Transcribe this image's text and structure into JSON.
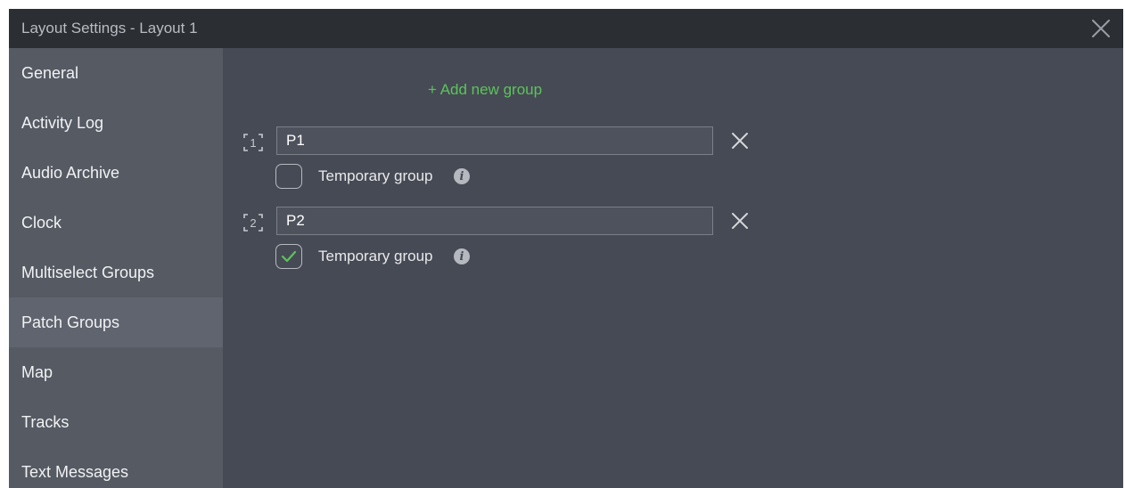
{
  "window": {
    "title": "Layout Settings - Layout 1"
  },
  "sidebar": {
    "items": [
      {
        "label": "General"
      },
      {
        "label": "Activity Log"
      },
      {
        "label": "Audio Archive"
      },
      {
        "label": "Clock"
      },
      {
        "label": "Multiselect Groups"
      },
      {
        "label": "Patch Groups",
        "active": true
      },
      {
        "label": "Map"
      },
      {
        "label": "Tracks"
      },
      {
        "label": "Text Messages"
      }
    ]
  },
  "main": {
    "add_group_label": "+ Add new group",
    "groups": [
      {
        "number": "1",
        "name": "P1",
        "temporary": false,
        "temporary_label": "Temporary group"
      },
      {
        "number": "2",
        "name": "P2",
        "temporary": true,
        "temporary_label": "Temporary group"
      }
    ]
  },
  "colors": {
    "accent_green": "#5cc35c",
    "titlebar": "#2b2e33",
    "sidebar": "#555a63",
    "sidebar_active": "#60646e",
    "content": "#464a54"
  }
}
